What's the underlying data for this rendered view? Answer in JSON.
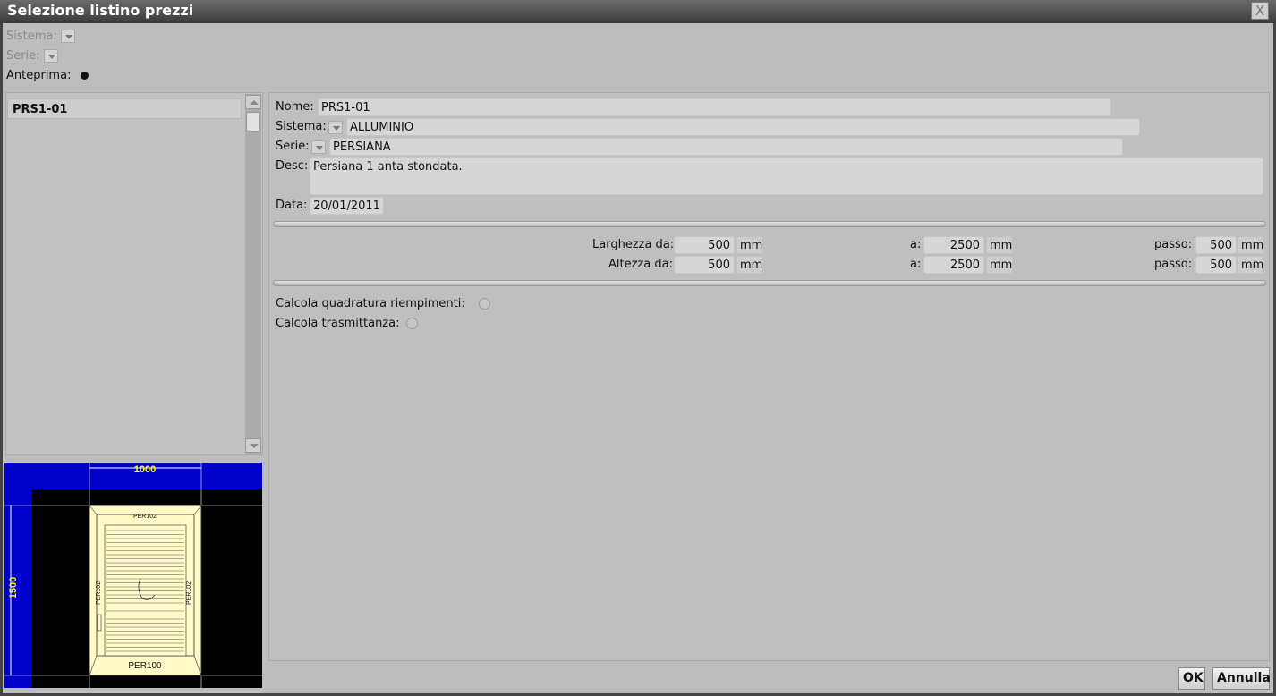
{
  "window": {
    "title": "Selezione listino prezzi",
    "close_glyph": "X"
  },
  "filters": {
    "sistema_label": "Sistema:",
    "serie_label": "Serie:",
    "anteprima_label": "Anteprima:"
  },
  "list": {
    "items": [
      {
        "label": "PRS1-01"
      }
    ]
  },
  "preview": {
    "width_dim": "1000",
    "height_dim": "1500",
    "profile_top": "PER102",
    "profile_left": "PER102",
    "profile_right": "PER102",
    "profile_bottom": "PER100"
  },
  "detail": {
    "nome_label": "Nome:",
    "nome_value": "PRS1-01",
    "sistema_label": "Sistema:",
    "sistema_value": "ALLUMINIO",
    "serie_label": "Serie:",
    "serie_value": "PERSIANA",
    "desc_label": "Desc:",
    "desc_value": "Persiana 1 anta stondata.",
    "data_label": "Data:",
    "data_value": "20/01/2011"
  },
  "dimensions": {
    "larghezza": {
      "label": "Larghezza da:",
      "from": "500",
      "to_label": "a:",
      "to": "2500",
      "step_label": "passo:",
      "step": "500",
      "unit": "mm"
    },
    "altezza": {
      "label": "Altezza da:",
      "from": "500",
      "to_label": "a:",
      "to": "2500",
      "step_label": "passo:",
      "step": "500",
      "unit": "mm"
    }
  },
  "options": {
    "quadratura_label": "Calcola quadratura riempimenti:",
    "trasmittanza_label": "Calcola trasmittanza:"
  },
  "buttons": {
    "ok": "OK",
    "cancel": "Annulla"
  }
}
